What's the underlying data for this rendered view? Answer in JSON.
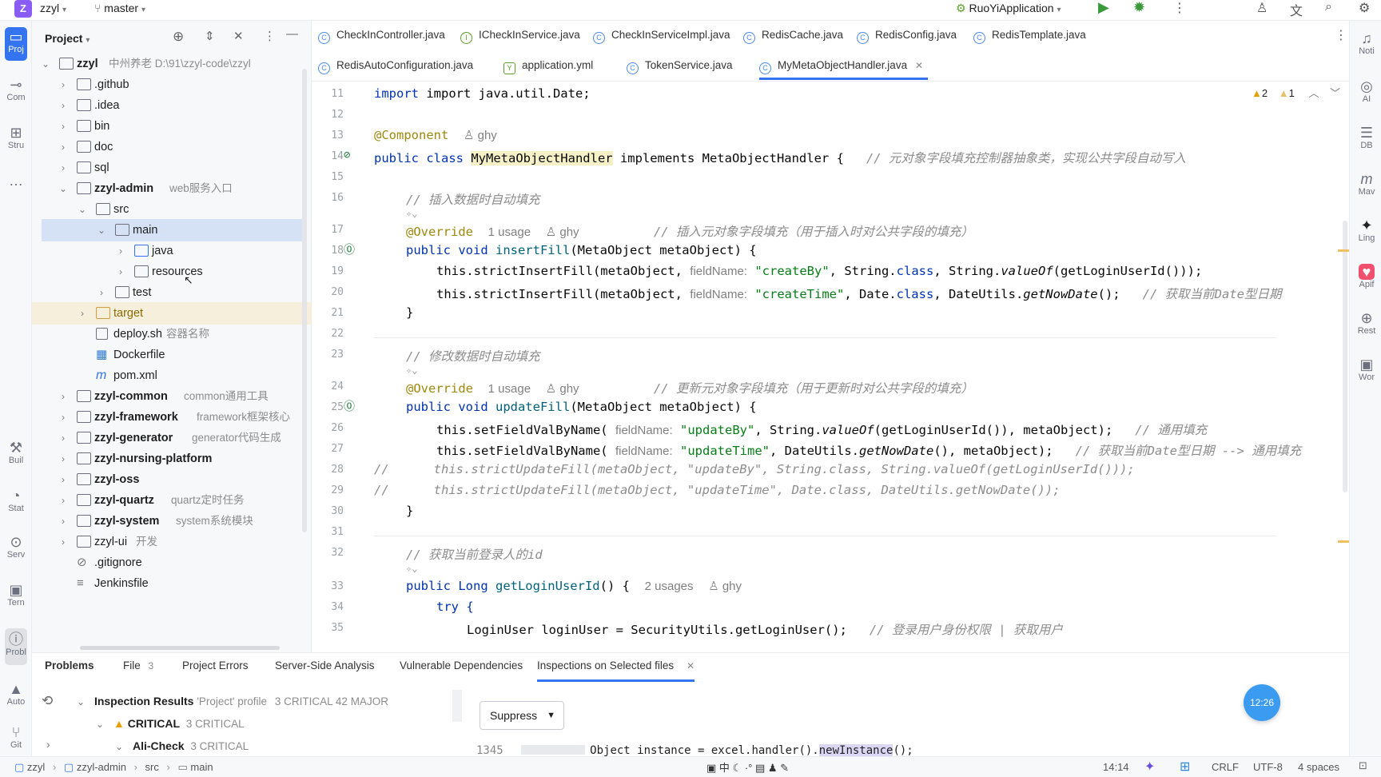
{
  "topbar": {
    "project_badge": "Z",
    "project": "zzyl",
    "branch": "master",
    "run_config": "RuoYiApplication"
  },
  "tabs_row1": [
    {
      "label": "CheckInController.java",
      "icon": "C"
    },
    {
      "label": "ICheckInService.java",
      "icon": "I"
    },
    {
      "label": "CheckInServiceImpl.java",
      "icon": "C"
    },
    {
      "label": "RedisCache.java",
      "icon": "C"
    },
    {
      "label": "RedisConfig.java",
      "icon": "C"
    },
    {
      "label": "RedisTemplate.java",
      "icon": "C"
    }
  ],
  "tabs_row2": [
    {
      "label": "RedisAutoConfiguration.java",
      "icon": "C"
    },
    {
      "label": "application.yml",
      "icon": "Y"
    },
    {
      "label": "TokenService.java",
      "icon": "C"
    },
    {
      "label": "MyMetaObjectHandler.java",
      "icon": "C"
    }
  ],
  "project_panel": {
    "title": "Project",
    "tree": [
      {
        "name": "zzyl",
        "extra": "中州养老 D:\\91\\zzyl-code\\zzyl"
      },
      {
        "name": ".github"
      },
      {
        "name": ".idea"
      },
      {
        "name": "bin"
      },
      {
        "name": "doc"
      },
      {
        "name": "sql"
      },
      {
        "name": "zzyl-admin",
        "extra": "web服务入口"
      },
      {
        "name": "src"
      },
      {
        "name": "main"
      },
      {
        "name": "java"
      },
      {
        "name": "resources"
      },
      {
        "name": "test"
      },
      {
        "name": "target"
      },
      {
        "name": "deploy.sh",
        "extra": "容器名称"
      },
      {
        "name": "Dockerfile"
      },
      {
        "name": "pom.xml"
      },
      {
        "name": "zzyl-common",
        "extra": "common通用工具"
      },
      {
        "name": "zzyl-framework",
        "extra": "framework框架核心"
      },
      {
        "name": "zzyl-generator",
        "extra": "generator代码生成"
      },
      {
        "name": "zzyl-nursing-platform"
      },
      {
        "name": "zzyl-oss"
      },
      {
        "name": "zzyl-quartz",
        "extra": "quartz定时任务"
      },
      {
        "name": "zzyl-system",
        "extra": "system系统模块"
      },
      {
        "name": "zzyl-ui",
        "extra": "开发"
      },
      {
        "name": ".gitignore"
      },
      {
        "name": "Jenkinsfile"
      }
    ]
  },
  "editor": {
    "warnings": "2",
    "weak_warnings": "1",
    "line_numbers": [
      "11",
      "12",
      "13",
      "14",
      "15",
      "16",
      "17",
      "18",
      "19",
      "20",
      "21",
      "22",
      "23",
      "24",
      "25",
      "26",
      "27",
      "28",
      "29",
      "30",
      "31",
      "32",
      "33",
      "34",
      "35"
    ],
    "lines": {
      "l11": "import java.util.Date;",
      "l13_ann": "@Component",
      "l13_author": "ghy",
      "l14_a": "public class ",
      "l14_b": "MyMetaObjectHandler",
      "l14_c": " implements MetaObjectHandler {",
      "l14_cm": "// 元对象字段填充控制器抽象类，实现公共字段自动写入",
      "l16": "// 插入数据时自动填充",
      "l17_ann": "@Override",
      "l17_usage": "1 usage",
      "l17_author": "ghy",
      "l17_cm": "// 插入元对象字段填充（用于插入时对公共字段的填充）",
      "l18_a": "public void ",
      "l18_b": "insertFill",
      "l18_c": "(MetaObject metaObject) {",
      "l19_a": "this.strictInsertFill(metaObject, ",
      "l19_hint": "fieldName:",
      "l19_s": "\"createBy\"",
      "l19_b": ", String.",
      "l19_c": "class",
      ", String.": "",
      "l19_d": ", String.",
      "l19_e": "valueOf",
      "l19_f": "(getLoginUserId()));",
      "l20_a": "this.strictInsertFill(metaObject, ",
      "l20_hint": "fieldName:",
      "l20_s": "\"createTime\"",
      "l20_b": ", Date.",
      "l20_c": "class",
      "l20_d": ", DateUtils.",
      "l20_e": "getNowDate",
      "l20_f": "();",
      "l20_cm": "// 获取当前Date型日期",
      "l21": "}",
      "l23": "// 修改数据时自动填充",
      "l24_ann": "@Override",
      "l24_usage": "1 usage",
      "l24_author": "ghy",
      "l24_cm": "// 更新元对象字段填充（用于更新时对公共字段的填充）",
      "l25_a": "public void ",
      "l25_b": "updateFill",
      "l25_c": "(MetaObject metaObject) {",
      "l26_a": "this.setFieldValByName( ",
      "l26_hint": "fieldName:",
      "l26_s": "\"updateBy\"",
      "l26_b": ", String.",
      "l26_e": "valueOf",
      "l26_f": "(getLoginUserId()), metaObject);",
      "l26_cm": "// 通用填充",
      "l27_a": "this.setFieldValByName( ",
      "l27_hint": "fieldName:",
      "l27_s": "\"updateTime\"",
      "l27_b": ", DateUtils.",
      "l27_e": "getNowDate",
      "l27_f": "(), metaObject);",
      "l27_cm": "// 获取当前Date型日期 --> 通用填充",
      "l28": "//      this.strictUpdateFill(metaObject, \"updateBy\", String.class, String.valueOf(getLoginUserId()));",
      "l29": "//      this.strictUpdateFill(metaObject, \"updateTime\", Date.class, DateUtils.getNowDate());",
      "l30": "}",
      "l32": "// 获取当前登录人的id",
      "l33_a": "public Long ",
      "l33_b": "getLoginUserId",
      "l33_c": "() {",
      "l33_usage": "2 usages",
      "l33_author": "ghy",
      "l34": "try {",
      "l35": "LoginUser loginUser = SecurityUtils.getLoginUser();",
      "l35_cm": "// 登录用户身份权限 | 获取用户"
    }
  },
  "bottom": {
    "tabs": [
      {
        "label": "Problems"
      },
      {
        "label": "File",
        "count": "3"
      },
      {
        "label": "Project Errors"
      },
      {
        "label": "Server-Side Analysis"
      },
      {
        "label": "Vulnerable Dependencies"
      },
      {
        "label": "Inspections on Selected files"
      }
    ],
    "results_title": "Inspection Results",
    "results_profile": "'Project' profile",
    "results_counts": "3 CRITICAL 42 MAJOR",
    "critical_label": "CRITICAL",
    "critical_count": "3 CRITICAL",
    "alicheck_label": "Ali-Check",
    "alicheck_count": "3 CRITICAL",
    "suppress": "Suppress",
    "preview_line": "1345",
    "preview_code_a": "Object instance = excel.handler().",
    "preview_code_b": "newInstance",
    "preview_code_c": "();"
  },
  "timer": "12:26",
  "statusbar": {
    "crumbs": [
      "zzyl",
      "zzyl-admin",
      "src",
      "main"
    ],
    "ime": "中",
    "position": "14:14",
    "line_sep": "CRLF",
    "encoding": "UTF-8",
    "indent": "4 spaces"
  },
  "left_tools": [
    "Proj",
    "Com",
    "Stru",
    "Buil",
    "Stat",
    "Serv",
    "Tern",
    "Probl",
    "Auto",
    "Git"
  ],
  "right_tools": [
    "Noti",
    "AI",
    "DB",
    "Mav",
    "Ling",
    "Apif",
    "Rest",
    "Wor"
  ]
}
